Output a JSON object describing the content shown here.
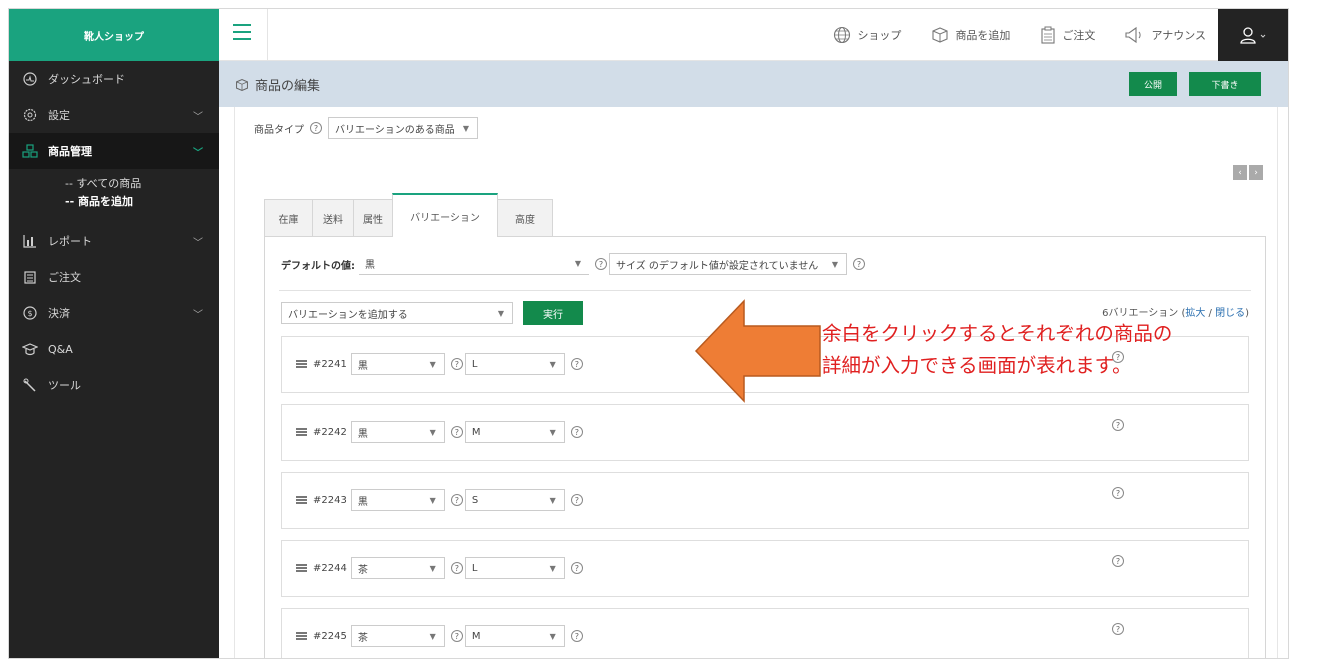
{
  "sidebar": {
    "brand": "靴人ショップ",
    "items": [
      {
        "label": "ダッシュボード",
        "icon": "dashboard-icon"
      },
      {
        "label": "設定",
        "icon": "settings-icon"
      },
      {
        "label": "商品管理",
        "icon": "products-icon"
      },
      {
        "label": "レポート",
        "icon": "report-icon"
      },
      {
        "label": "ご注文",
        "icon": "orders-icon"
      },
      {
        "label": "決済",
        "icon": "payment-icon"
      },
      {
        "label": "Q&A",
        "icon": "qa-icon"
      },
      {
        "label": "ツール",
        "icon": "tools-icon"
      }
    ],
    "submenu": [
      "-- すべての商品",
      "-- 商品を追加"
    ]
  },
  "topbar": {
    "links": [
      "ショップ",
      "商品を追加",
      "ご注文",
      "アナウンス"
    ]
  },
  "page": {
    "title": "商品の編集",
    "publish_label": "公開",
    "draft_label": "下書き",
    "product_type_label": "商品タイプ",
    "product_type_value": "バリエーションのある商品"
  },
  "tabs": [
    "在庫",
    "送料",
    "属性",
    "バリエーション",
    "高度"
  ],
  "variations": {
    "default_label": "デフォルトの値:",
    "default_color": "黒",
    "default_size": "サイズ のデフォルト値が設定されていません",
    "add_select": "バリエーションを追加する",
    "go_label": "実行",
    "count_text": "6バリエーション (",
    "expand_label": "拡大",
    "slash": " / ",
    "close_label": "閉じる",
    "close_paren": ")",
    "rows": [
      {
        "id": "#2241",
        "color": "黒",
        "size": "L"
      },
      {
        "id": "#2242",
        "color": "黒",
        "size": "M"
      },
      {
        "id": "#2243",
        "color": "黒",
        "size": "S"
      },
      {
        "id": "#2244",
        "color": "茶",
        "size": "L"
      },
      {
        "id": "#2245",
        "color": "茶",
        "size": "M"
      }
    ]
  },
  "callout": {
    "line1": "余白をクリックするとそれぞれの商品の",
    "line2": "詳細が入力できる画面が表れます。",
    "color": "#e02020",
    "arrow_color": "#ee7d35"
  },
  "colors": {
    "accent": "#1aa37f",
    "button": "#138a4c",
    "sidebar": "#232323",
    "header": "#d2dde8"
  }
}
